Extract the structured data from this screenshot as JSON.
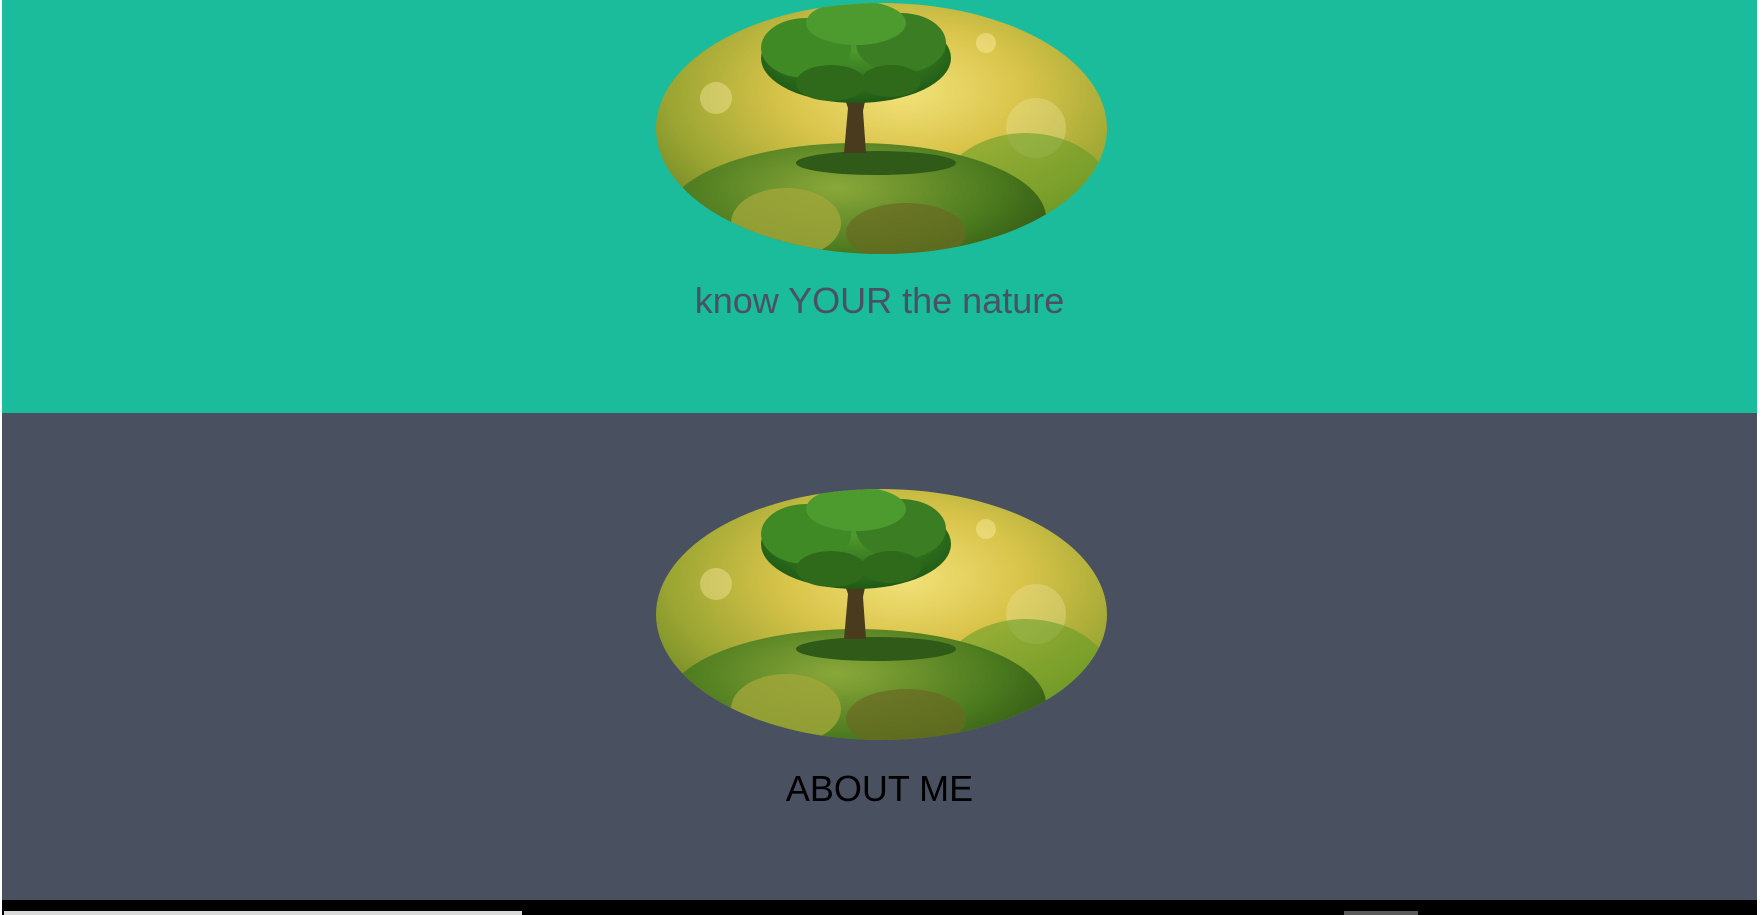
{
  "hero": {
    "heading": "know YOUR the nature",
    "image_name": "tree-on-hand-image"
  },
  "about": {
    "heading": "ABOUT ME",
    "image_name": "tree-on-hand-image"
  },
  "colors": {
    "hero_bg": "#1abc9c",
    "about_bg": "#495060",
    "hero_text": "#4a5163",
    "about_text": "#000000"
  }
}
